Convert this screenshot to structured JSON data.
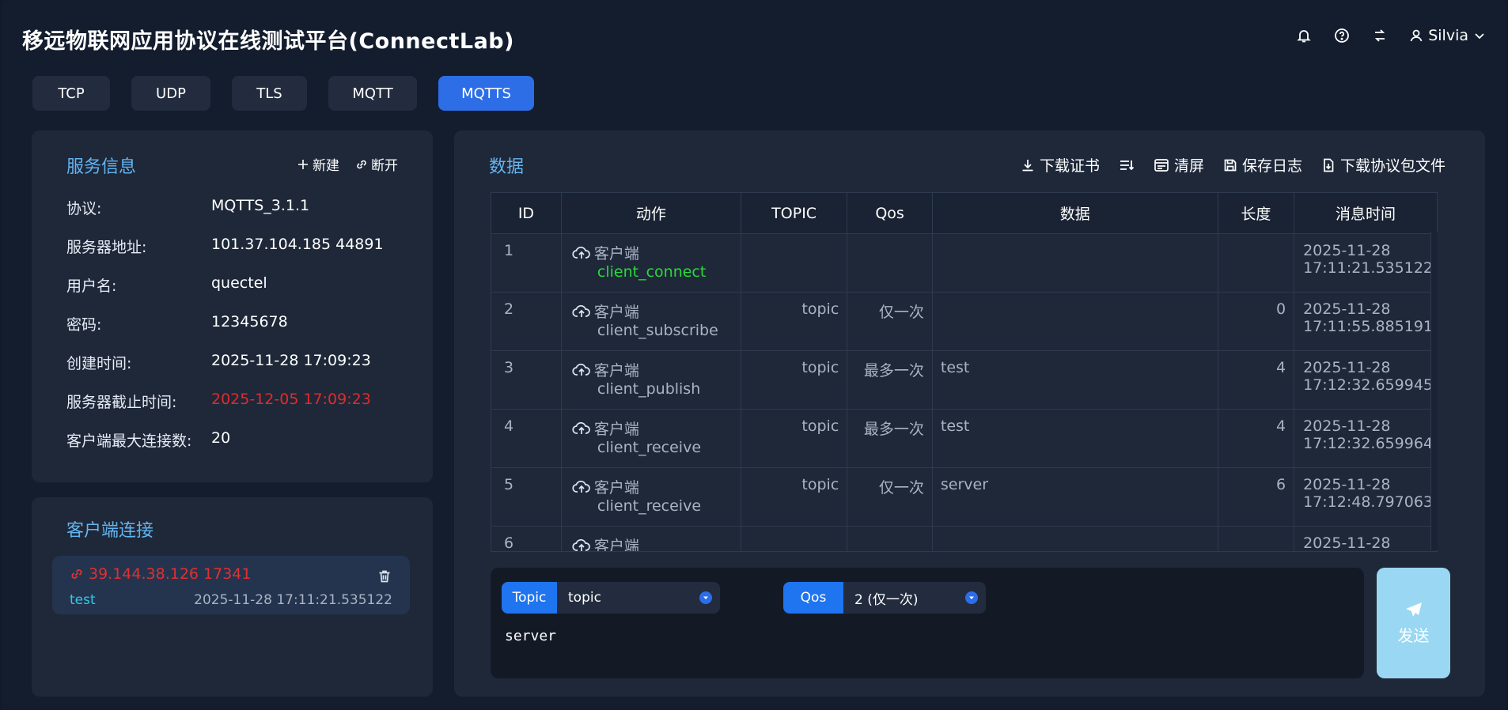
{
  "app": {
    "title": "移远物联网应用协议在线测试平台(ConnectLab)",
    "user": "Silvia"
  },
  "tabs": [
    {
      "label": "TCP",
      "active": false
    },
    {
      "label": "UDP",
      "active": false
    },
    {
      "label": "TLS",
      "active": false
    },
    {
      "label": "MQTT",
      "active": false
    },
    {
      "label": "MQTTS",
      "active": true
    }
  ],
  "service": {
    "title": "服务信息",
    "new_label": "新建",
    "disconnect_label": "断开",
    "rows": [
      {
        "label": "协议:",
        "value": "MQTTS_3.1.1"
      },
      {
        "label": "服务器地址:",
        "value": "101.37.104.185 44891"
      },
      {
        "label": "用户名:",
        "value": "quectel"
      },
      {
        "label": "密码:",
        "value": "12345678"
      },
      {
        "label": "创建时间:",
        "value": "2025-11-28 17:09:23"
      },
      {
        "label": "服务器截止时间:",
        "value": "2025-12-05 17:09:23"
      },
      {
        "label": "客户端最大连接数:",
        "value": "20"
      }
    ]
  },
  "clients": {
    "title": "客户端连接",
    "items": [
      {
        "address": "39.144.38.126 17341",
        "name": "test",
        "time": "2025-11-28 17:11:21.535122"
      }
    ]
  },
  "data_panel": {
    "title": "数据",
    "actions": {
      "download_cert": "下载证书",
      "clear": "清屏",
      "save_log": "保存日志",
      "download_pkg": "下载协议包文件"
    },
    "columns": [
      "ID",
      "动作",
      "TOPIC",
      "Qos",
      "数据",
      "长度",
      "消息时间"
    ],
    "rows": [
      {
        "id": "1",
        "source": "客户端",
        "event": "client_connect",
        "topic": "",
        "qos": "",
        "data": "",
        "length": "",
        "date": "2025-11-28",
        "time": "17:11:21.535122"
      },
      {
        "id": "2",
        "source": "客户端",
        "event": "client_subscribe",
        "topic": "topic",
        "qos": "仅一次",
        "data": "",
        "length": "0",
        "date": "2025-11-28",
        "time": "17:11:55.885191"
      },
      {
        "id": "3",
        "source": "客户端",
        "event": "client_publish",
        "topic": "topic",
        "qos": "最多一次",
        "data": "test",
        "length": "4",
        "date": "2025-11-28",
        "time": "17:12:32.659945"
      },
      {
        "id": "4",
        "source": "客户端",
        "event": "client_receive",
        "topic": "topic",
        "qos": "最多一次",
        "data": "test",
        "length": "4",
        "date": "2025-11-28",
        "time": "17:12:32.659964"
      },
      {
        "id": "5",
        "source": "客户端",
        "event": "client_receive",
        "topic": "topic",
        "qos": "仅一次",
        "data": "server",
        "length": "6",
        "date": "2025-11-28",
        "time": "17:12:48.797063"
      },
      {
        "id": "6",
        "source": "客户端",
        "event": "",
        "topic": "",
        "qos": "",
        "data": "",
        "length": "",
        "date": "2025-11-28",
        "time": ""
      }
    ]
  },
  "send": {
    "topic_label": "Topic",
    "topic_value": "topic",
    "qos_label": "Qos",
    "qos_value": "2 (仅一次)",
    "message": "server",
    "send_label": "发送"
  },
  "colors": {
    "accent": "#2d6ee6",
    "title_blue": "#64b4f0",
    "error_red": "#e02b2b",
    "ok_green": "#2bd93a"
  }
}
